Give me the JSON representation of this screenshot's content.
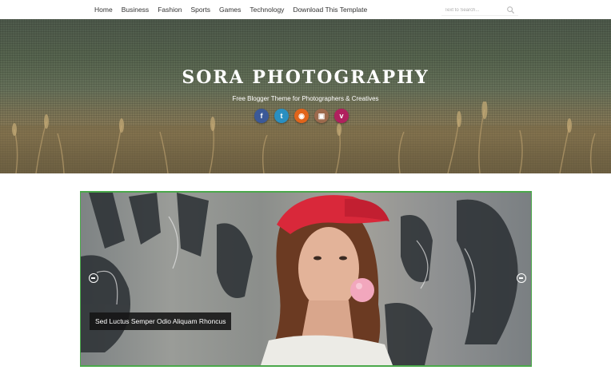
{
  "nav": {
    "links": [
      "Home",
      "Business",
      "Fashion",
      "Sports",
      "Games",
      "Technology",
      "Download This Template"
    ]
  },
  "search": {
    "placeholder": "Text to Search...",
    "icon": "search-icon"
  },
  "header": {
    "title": "SORA PHOTOGRAPHY",
    "description": "Free Blogger Theme for Photographers & Creatives",
    "social": [
      {
        "name": "facebook-icon",
        "glyph": "f",
        "color": "#3b5998"
      },
      {
        "name": "twitter-icon",
        "glyph": "t",
        "color": "#2a8fc1"
      },
      {
        "name": "rss-icon",
        "glyph": "◉",
        "color": "#e0641b"
      },
      {
        "name": "instagram-icon",
        "glyph": "▣",
        "color": "#9c6a4d"
      },
      {
        "name": "vimeo-icon",
        "glyph": "v",
        "color": "#b0215e"
      }
    ]
  },
  "slider": {
    "caption": "Sed Luctus Semper Odio Aliquam Rhoncus",
    "accent": "#4aa84a"
  }
}
